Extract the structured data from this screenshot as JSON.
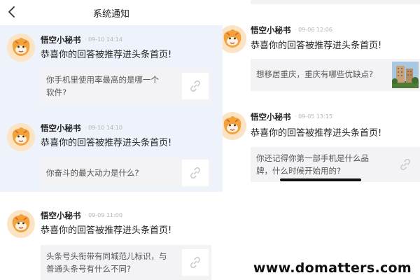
{
  "header": {
    "title": "系统通知"
  },
  "notifications_left": [
    {
      "sender": "悟空小秘书",
      "meta": "· 09-10 14:14",
      "message": "恭喜你的回答被推荐进头条首页!",
      "question_line1": "你手机里使用率最高的是哪一个",
      "question_line2": "软件?"
    },
    {
      "sender": "悟空小秘书",
      "meta": "· 09-10 14:10",
      "message": "恭喜你的回答被推荐进头条首页!",
      "question_line1": "你奋斗的最大动力是什么?",
      "question_line2": ""
    },
    {
      "sender": "悟空小秘书",
      "meta": "· 09-09 11:00",
      "message": "恭喜你的回答被推荐进头条首页!",
      "question_line1": "头条号头衔带有同城范儿标识，与",
      "question_line2": "普通头条号有什么不同?"
    }
  ],
  "notifications_right": [
    {
      "sender": "悟空小秘书",
      "meta": "· 09-06 12:06",
      "message": "恭喜你的回答被推荐进头条首页!",
      "question_line1": "想移居重庆，重庆有哪些优缺点?",
      "question_line2": ""
    },
    {
      "sender": "悟空小秘书",
      "meta": "· 09-05 13:15",
      "message": "恭喜你的回答被推荐进头条首页!",
      "question_line1": "你还记得你第一部手机是什么品",
      "question_line2": "牌，什么时候开始用的?"
    }
  ],
  "watermark": "www.domatters.com",
  "colors": {
    "highlight_bg": "#eef2fb",
    "question_bg": "#f3f3f5",
    "meta_text": "#b5b5b5"
  }
}
